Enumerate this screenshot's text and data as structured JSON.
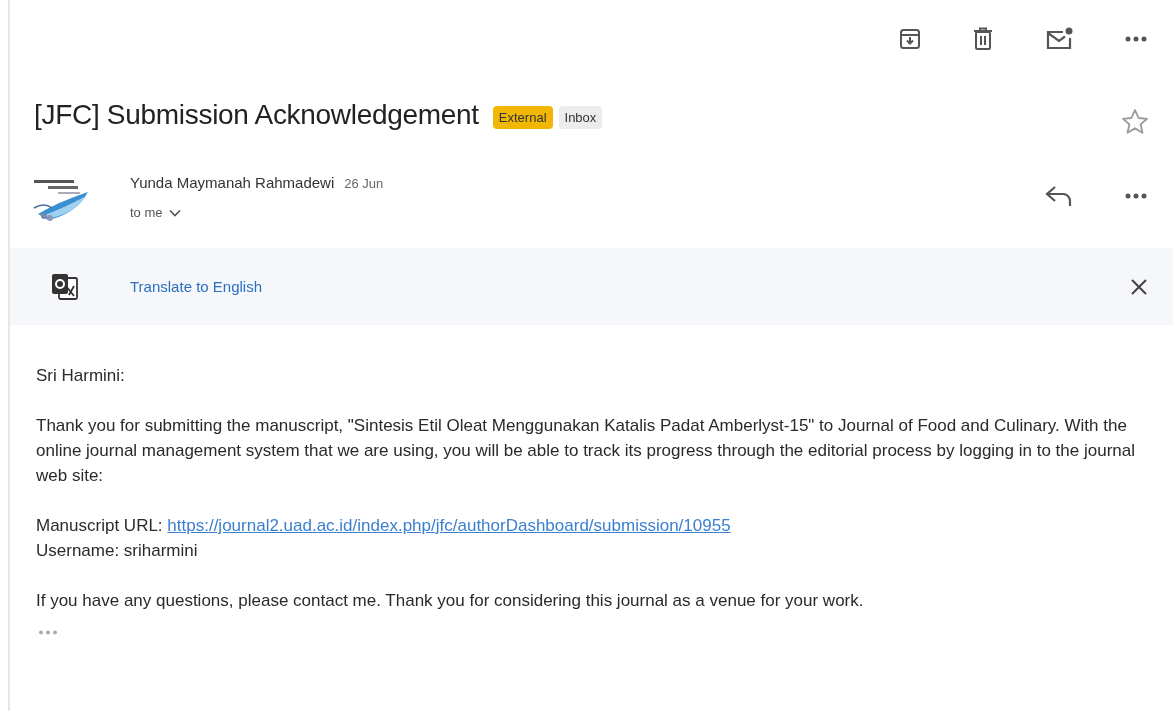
{
  "subject": "[JFC] Submission Acknowledgement",
  "labels": [
    {
      "text": "External",
      "color": "#f2b705"
    },
    {
      "text": "Inbox",
      "color": "#ececec"
    }
  ],
  "starred": false,
  "sender": {
    "name": "Yunda Maymanah Rahmadewi",
    "date": "26 Jun",
    "recipient": "to me"
  },
  "translate": {
    "label": "Translate to English"
  },
  "body": [
    {
      "lines": [
        {
          "text": "Sri Harmini:"
        }
      ]
    },
    {
      "lines": [
        {
          "text": "Thank you for submitting the manuscript, \"Sintesis Etil Oleat Menggunakan Katalis Padat Amberlyst-15\" to Journal of Food and Culinary. With the online journal management system that we are using, you will be able to track its progress through the editorial process by logging in to the journal web site:"
        }
      ]
    },
    {
      "lines": [
        {
          "text": "Manuscript URL:",
          "link": "https://journal2.uad.ac.id/index.php/jfc/authorDashboard/submission/10955"
        },
        {
          "text": "Username: sriharmini"
        }
      ]
    },
    {
      "lines": [
        {
          "text": "If you have any questions, please contact me. Thank you for considering this journal as a venue for your work."
        }
      ]
    }
  ]
}
